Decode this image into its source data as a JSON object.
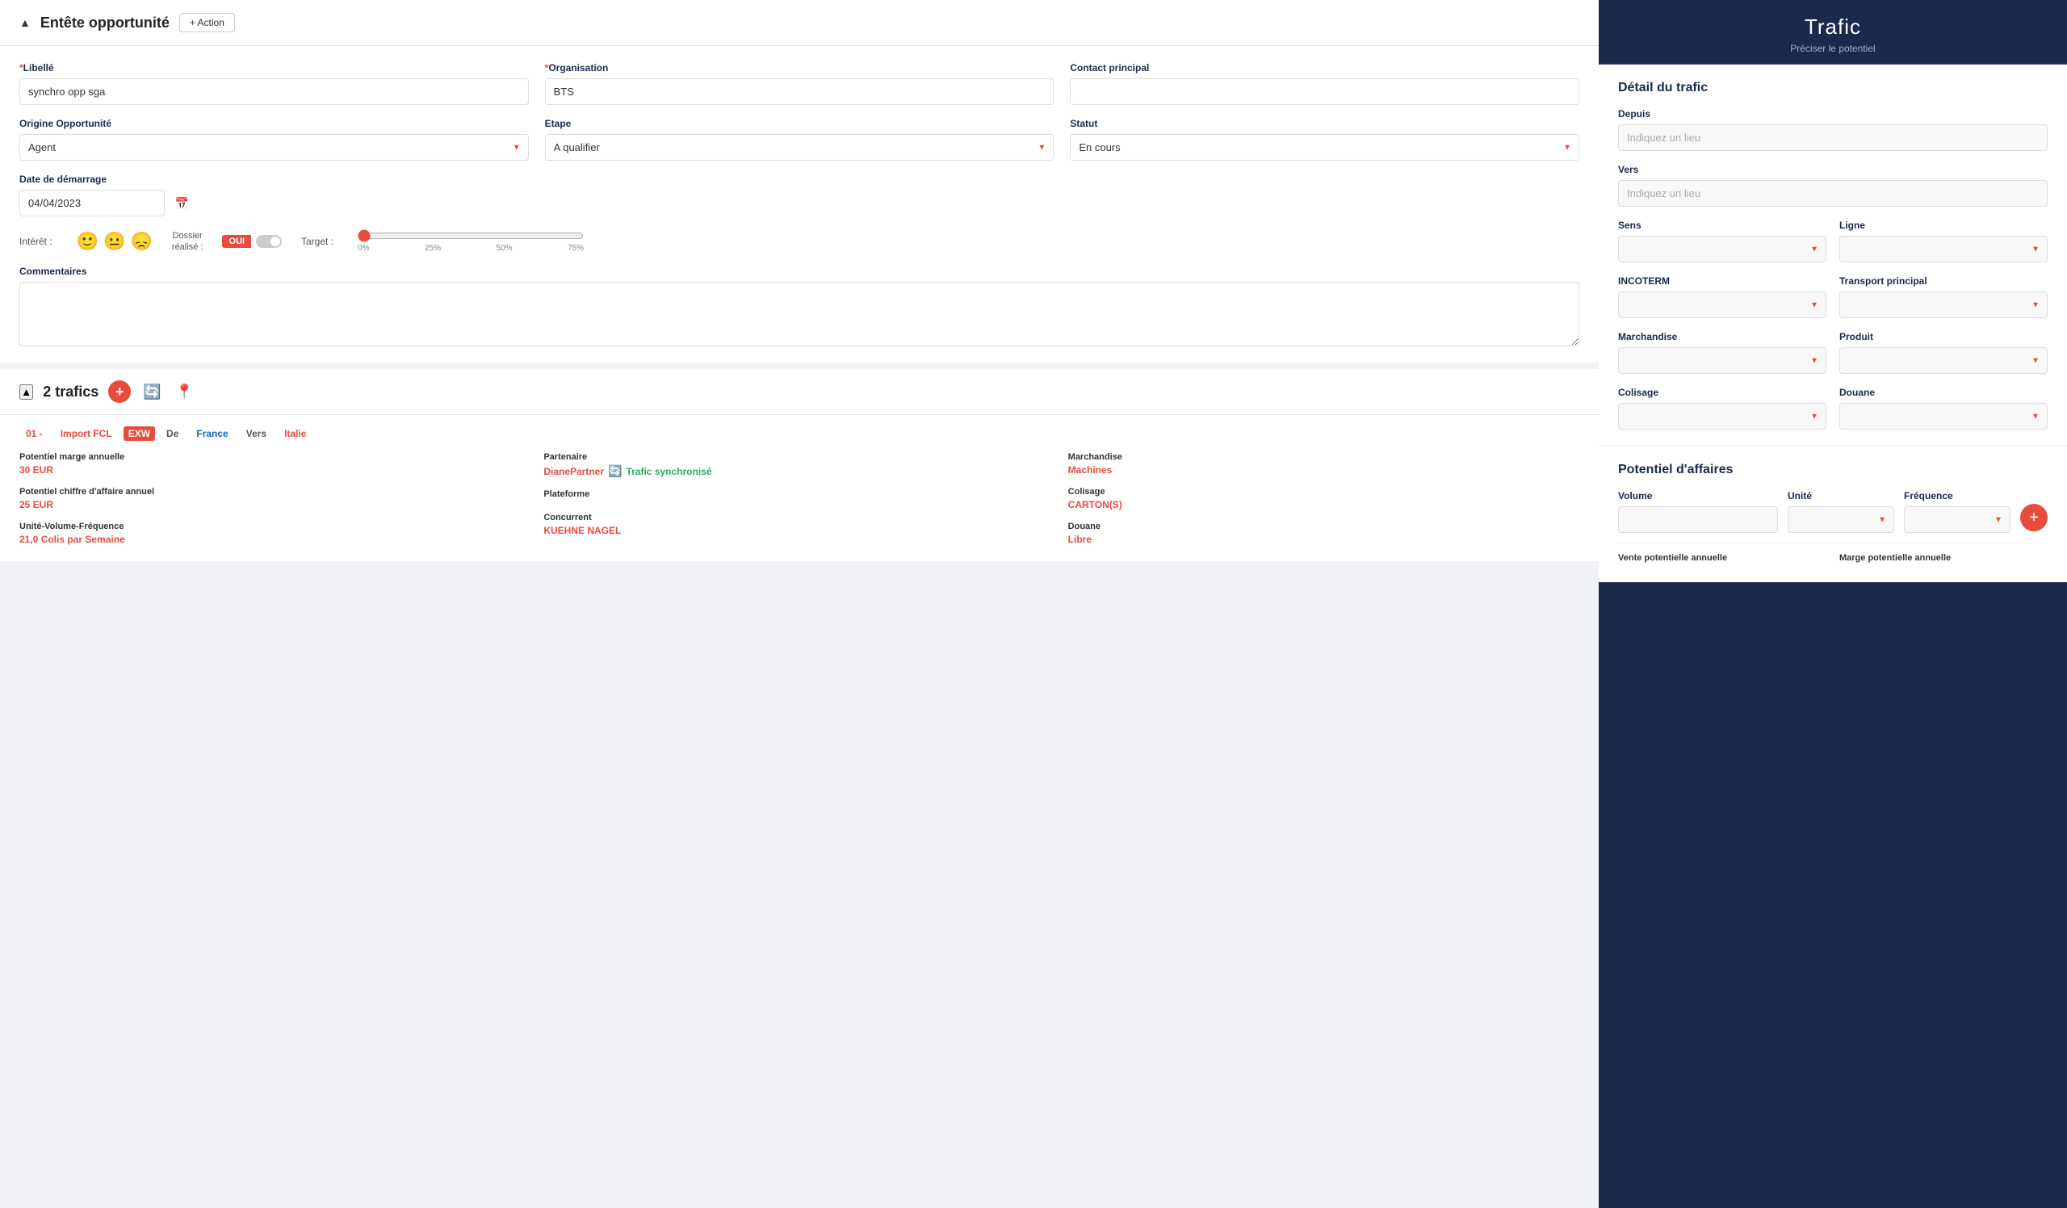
{
  "left": {
    "header": {
      "collapse_icon": "▲",
      "title": "Entête opportunité",
      "action_button": "+ Action"
    },
    "form": {
      "libelle_label": "*Libellé",
      "libelle_value": "synchro opp sga",
      "organisation_label": "*Organisation",
      "organisation_value": "BTS",
      "contact_label": "Contact principal",
      "contact_value": "",
      "origine_label": "Origine Opportunité",
      "origine_value": "Agent",
      "etape_label": "Etape",
      "etape_value": "A qualifier",
      "statut_label": "Statut",
      "statut_value": "En cours",
      "date_label": "Date de démarrage",
      "date_value": "04/04/2023",
      "interet_label": "Intérêt :",
      "dossier_label": "Dossier",
      "dossier_sub": "réalisé :",
      "toggle_oui": "OUI",
      "target_label": "Target :",
      "slider_pct_labels": [
        "0%",
        "25%",
        "50%",
        "75%"
      ],
      "slider_value": 0,
      "comments_label": "Commentaires",
      "comments_placeholder": ""
    },
    "trafics": {
      "count": "2 trafics",
      "card": {
        "tag_number": "01",
        "tag_type": "Import FCL",
        "tag_incoterm": "EXW",
        "tag_de": "De",
        "tag_from": "France",
        "tag_vers": "Vers",
        "tag_to": "Italie",
        "fields": [
          {
            "label": "Potentiel marge annuelle",
            "value": "30 EUR",
            "col": 1
          },
          {
            "label": "Partenaire",
            "value": "DianePartner",
            "extra": "Trafic synchronisé",
            "col": 2
          },
          {
            "label": "Marchandise",
            "value": "Machines",
            "col": 3
          },
          {
            "label": "Potentiel chiffre d'affaire annuel",
            "value": "25 EUR",
            "col": 1
          },
          {
            "label": "Plateforme",
            "value": "",
            "col": 2
          },
          {
            "label": "Colisage",
            "value": "CARTON(S)",
            "col": 3
          },
          {
            "label": "Unité-Volume-Fréquence",
            "value": "21,0 Colis par Semaine",
            "col": 1
          },
          {
            "label": "Concurrent",
            "value": "KUEHNE NAGEL",
            "col": 2
          },
          {
            "label": "Douane",
            "value": "Libre",
            "col": 3
          }
        ]
      }
    }
  },
  "right": {
    "header": {
      "title": "Trafic",
      "subtitle": "Préciser le potentiel"
    },
    "detail": {
      "title": "Détail du trafic",
      "depuis_label": "Depuis",
      "depuis_placeholder": "Indiquez un lieu",
      "vers_label": "Vers",
      "vers_placeholder": "Indiquez un lieu",
      "sens_label": "Sens",
      "sens_value": "",
      "ligne_label": "Ligne",
      "ligne_value": "",
      "incoterm_label": "INCOTERM",
      "incoterm_value": "",
      "transport_label": "Transport principal",
      "transport_value": "",
      "marchandise_label": "Marchandise",
      "marchandise_value": "",
      "produit_label": "Produit",
      "produit_value": "",
      "colisage_label": "Colisage",
      "colisage_value": "",
      "douane_label": "Douane",
      "douane_value": ""
    },
    "potentiel": {
      "title": "Potentiel d'affaires",
      "volume_label": "Volume",
      "volume_value": "",
      "unite_label": "Unité",
      "unite_value": "",
      "frequence_label": "Fréquence",
      "frequence_value": "",
      "add_button": "+",
      "vente_label": "Vente potentielle annuelle",
      "marge_label": "Marge potentielle annuelle"
    }
  }
}
